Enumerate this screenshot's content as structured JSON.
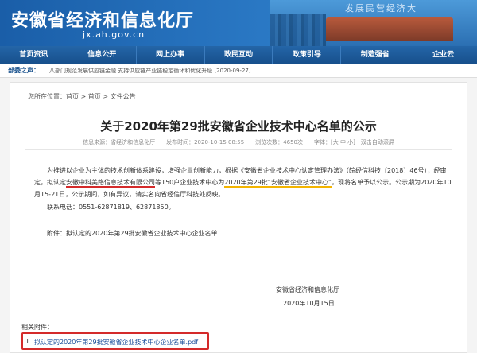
{
  "header": {
    "title": "安徽省经济和信息化厅",
    "domain": "jx.ah.gov.cn",
    "banner_text": "发展民营经济大"
  },
  "nav": [
    "首页资讯",
    "信息公开",
    "网上办事",
    "政民互动",
    "政策引导",
    "制造强省",
    "企业云"
  ],
  "notice": {
    "label": "部委之声：",
    "text": "八部门规范发展供应链金融 支持供应链产业链稳定循环和优化升级 [2020-09-27]"
  },
  "breadcrumb": "您所在位置：首页 > 首页 > 文件公告",
  "article": {
    "title": "关于2020年第29批安徽省企业技术中心名单的公示",
    "meta": "信息来源：省经济和信息化厅　　发布时间：2020-10-15 08:55　　浏览次数：4650次　　字体：[大 中 小]　双击自动滚屏",
    "p1_a": "为推进以企业为主体的技术创新体系建设，增强企业创新能力，根据《安徽省企业技术中心认定管理办法》（皖经信科技〔2018〕46号），经审定，拟认定",
    "p1_company": "安徽中科美络信息技术有限公司",
    "p1_b": "等150户企业技术中心为",
    "p1_batch": "2020年第29批“安徽省企业技术中心”",
    "p1_c": "，现将名单予以公示。公示期为2020年10月15-21日，公示期间，如有异议，请实名向省经信厅科技处反映。",
    "contact": "联系电话：0551-62871819、62871850。",
    "attachment_note": "附件：拟认定的2020年第29批安徽省企业技术中心企业名单",
    "sign_org": "安徽省经济和信息化厅",
    "sign_date": "2020年10月15日",
    "related_label": "相关附件：",
    "attachment_num": "1.",
    "attachment_link": "拟认定的2020年第29批安徽省企业技术中心企业名单.pdf"
  }
}
